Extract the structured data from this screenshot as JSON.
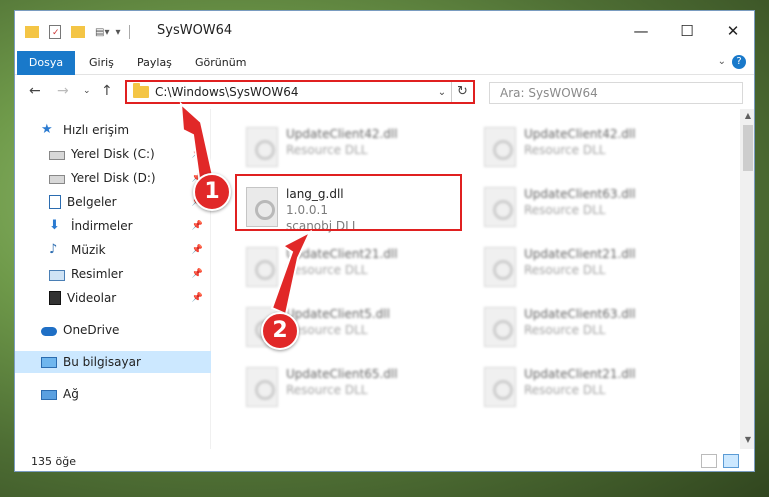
{
  "window": {
    "title": "SysWOW64",
    "tabs": [
      "Dosya",
      "Giriş",
      "Paylaş",
      "Görünüm"
    ]
  },
  "address": {
    "path": "C:\\Windows\\SysWOW64",
    "search_placeholder": "Ara: SysWOW64"
  },
  "sidebar": {
    "items": [
      {
        "label": "Hızlı erişim",
        "icon": "star-icon"
      },
      {
        "label": "Yerel Disk (C:)",
        "icon": "drive-icon"
      },
      {
        "label": "Yerel Disk (D:)",
        "icon": "drive-icon"
      },
      {
        "label": "Belgeler",
        "icon": "documents-icon"
      },
      {
        "label": "İndirmeler",
        "icon": "download-icon"
      },
      {
        "label": "Müzik",
        "icon": "music-icon"
      },
      {
        "label": "Resimler",
        "icon": "pictures-icon"
      },
      {
        "label": "Videolar",
        "icon": "video-icon"
      },
      {
        "label": "OneDrive",
        "icon": "cloud-icon"
      },
      {
        "label": "Bu bilgisayar",
        "icon": "computer-icon"
      },
      {
        "label": "Ağ",
        "icon": "network-icon"
      }
    ]
  },
  "files": [
    {
      "name": "UpdateClient42.dll",
      "desc": "Resource DLL"
    },
    {
      "name": "UpdateClient42.dll",
      "desc": "Resource DLL"
    },
    {
      "name": "lang_g.dll",
      "version": "1.0.0.1",
      "desc": "scanobj DLL"
    },
    {
      "name": "UpdateClient63.dll",
      "desc": "Resource DLL"
    },
    {
      "name": "UpdateClient21.dll",
      "desc": "Resource DLL"
    },
    {
      "name": "UpdateClient21.dll",
      "desc": "Resource DLL"
    },
    {
      "name": "UpdateClient5.dll",
      "desc": "Resource DLL"
    },
    {
      "name": "UpdateClient63.dll",
      "desc": "Resource DLL"
    },
    {
      "name": "UpdateClient65.dll",
      "desc": "Resource DLL"
    },
    {
      "name": "UpdateClient21.dll",
      "desc": "Resource DLL"
    }
  ],
  "status": {
    "item_count": "135 öğe"
  },
  "callouts": {
    "step1": "1",
    "step2": "2"
  },
  "colors": {
    "accent": "#1979ca",
    "highlight": "#e02020",
    "selected": "#cce8ff"
  }
}
